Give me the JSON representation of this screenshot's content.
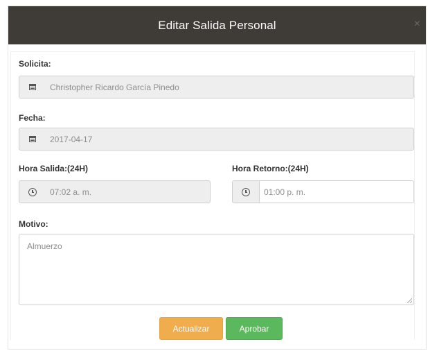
{
  "modal": {
    "title": "Editar Salida Personal",
    "close_icon": "close-icon"
  },
  "form": {
    "requester": {
      "label": "Solicita:",
      "value": "Christopher Ricardo García Pinedo",
      "icon": "calendar-icon"
    },
    "date": {
      "label": "Fecha:",
      "value": "2017-04-17",
      "icon": "calendar-icon"
    },
    "departure_time": {
      "label": "Hora Salida:(24H)",
      "value": "07:02 a. m.",
      "icon": "clock-icon"
    },
    "return_time": {
      "label": "Hora Retorno:(24H)",
      "value": "01:00 p. m.",
      "icon": "clock-icon"
    },
    "reason": {
      "label": "Motivo:",
      "value": "Almuerzo"
    }
  },
  "actions": {
    "update_label": "Actualizar",
    "approve_label": "Aprobar"
  },
  "colors": {
    "header_bg": "#3f3b36",
    "update_button": "#f0ad4e",
    "approve_button": "#5cb85c",
    "readonly_field_bg": "#eeeeee"
  }
}
